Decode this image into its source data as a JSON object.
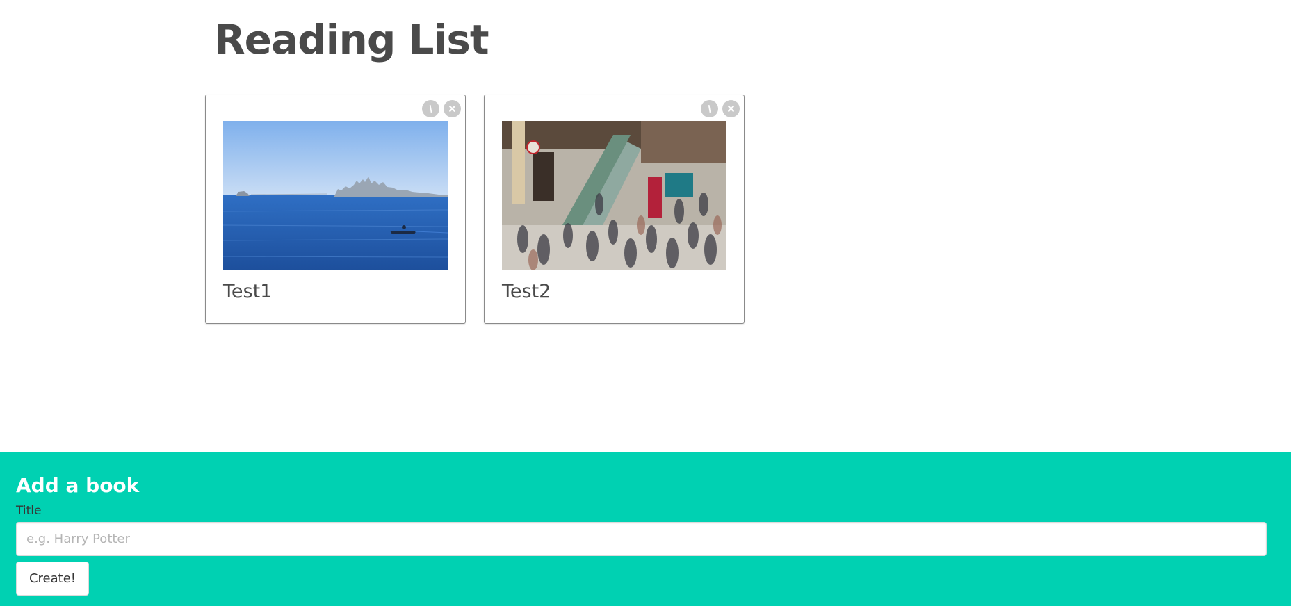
{
  "header": {
    "title": "Reading List"
  },
  "books": [
    {
      "title": "Test1",
      "image": "bay-skyline-boat-photo",
      "edit_icon": "pencil-icon",
      "delete_icon": "close-icon"
    },
    {
      "title": "Test2",
      "image": "crowded-station-escalator-photo",
      "edit_icon": "pencil-icon",
      "delete_icon": "close-icon"
    }
  ],
  "add_form": {
    "heading": "Add a book",
    "title_label": "Title",
    "title_value": "",
    "title_placeholder": "e.g. Harry Potter",
    "submit_label": "Create!"
  },
  "colors": {
    "accent": "#00d1b2",
    "text": "#4a4a4a",
    "icon_bg": "#c9c9c9"
  }
}
